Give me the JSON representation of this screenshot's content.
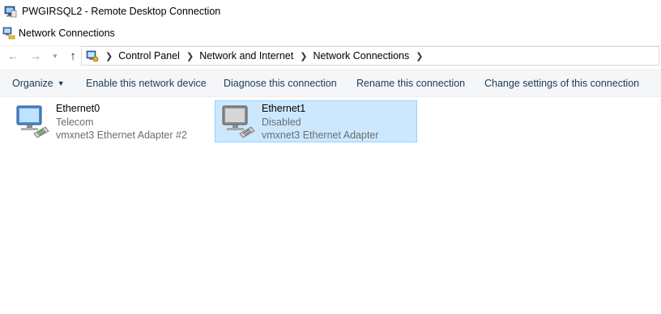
{
  "rdp_title": "PWGIRSQL2 - Remote Desktop Connection",
  "window_title": "Network Connections",
  "breadcrumb": [
    "Control Panel",
    "Network and Internet",
    "Network Connections"
  ],
  "toolbar": {
    "organize": "Organize",
    "enable": "Enable this network device",
    "diagnose": "Diagnose this connection",
    "rename": "Rename this connection",
    "change": "Change settings of this connection"
  },
  "connections": [
    {
      "name": "Ethernet0",
      "status": "Telecom",
      "adapter": "vmxnet3 Ethernet Adapter #2",
      "selected": false
    },
    {
      "name": "Ethernet1",
      "status": "Disabled",
      "adapter": "vmxnet3 Ethernet Adapter",
      "selected": true
    }
  ],
  "icons": {
    "rdp": "remote-desktop-icon",
    "window": "network-connections-icon",
    "back": "back-arrow-icon",
    "forward": "forward-arrow-icon",
    "recent": "chevron-down-icon",
    "up": "up-arrow-icon",
    "location": "control-panel-icon"
  }
}
